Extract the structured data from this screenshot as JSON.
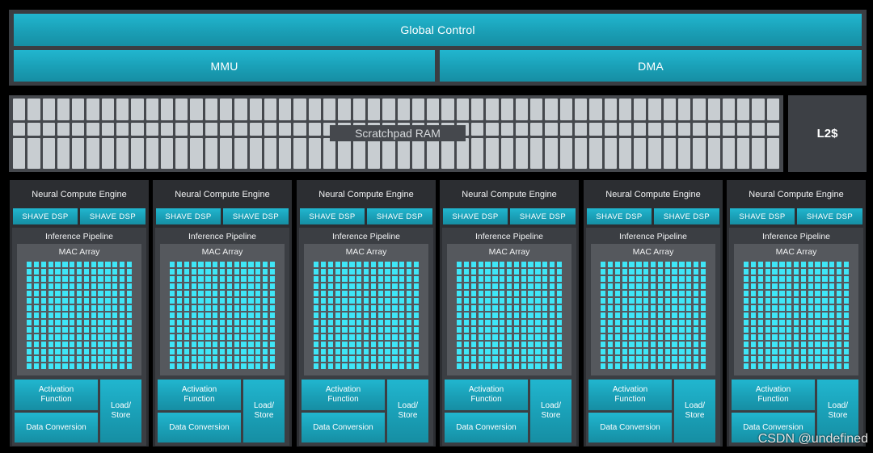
{
  "top": {
    "global_control": "Global Control",
    "mmu": "MMU",
    "dma": "DMA"
  },
  "memory": {
    "scratchpad_label": "Scratchpad RAM",
    "l2_label": "L2$"
  },
  "nce": {
    "title": "Neural Compute Engine",
    "shave_dsp": "SHAVE DSP",
    "inference_pipeline": "Inference Pipeline",
    "mac_array": "MAC Array",
    "activation_function": "Activation Function",
    "data_conversion": "Data Conversion",
    "load_store": "Load/ Store"
  },
  "watermark": "CSDN @undefined",
  "colors": {
    "accent_teal": "#1a9fb6",
    "mac_cell": "#3fe6f7",
    "background": "#000000"
  }
}
